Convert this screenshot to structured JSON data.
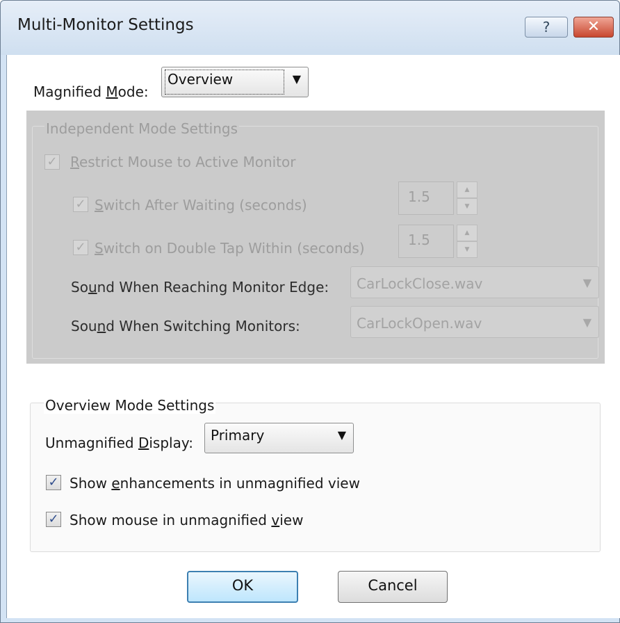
{
  "window": {
    "title": "Multi-Monitor Settings",
    "help_glyph": "?",
    "close_glyph": "✕"
  },
  "magnified_mode": {
    "label_pre": "Magnified ",
    "label_key": "M",
    "label_post": "ode:",
    "value": "Overview"
  },
  "independent": {
    "group_title": "Independent Mode Settings",
    "restrict_mouse": {
      "key": "R",
      "rest": "estrict Mouse to Active Monitor",
      "checked": true
    },
    "switch_after_waiting": {
      "key": "S",
      "rest": "witch After Waiting (seconds)",
      "value": "1.5",
      "checked": true
    },
    "switch_double_tap": {
      "key": "S",
      "rest": "witch on Double Tap Within (seconds)",
      "value": "1.5",
      "checked": true
    },
    "sound_edge": {
      "pre": "So",
      "key": "u",
      "post": "nd When Reaching Monitor Edge:",
      "value": "CarLockClose.wav"
    },
    "sound_switch": {
      "pre": "Sou",
      "key": "n",
      "post": "d When Switching Monitors:",
      "value": "CarLockOpen.wav"
    }
  },
  "overview": {
    "group_title": "Overview Mode Settings",
    "unmagnified_display": {
      "pre": "Unmagnified ",
      "key": "D",
      "post": "isplay:",
      "value": "Primary"
    },
    "show_enhancements": {
      "pre": "Show ",
      "key": "e",
      "post": "nhancements in unmagnified view",
      "checked": true
    },
    "show_mouse": {
      "pre": "Show mouse in unmagnified ",
      "key": "v",
      "post": "iew",
      "checked": true
    }
  },
  "buttons": {
    "ok": "OK",
    "cancel": "Cancel"
  },
  "icons": {
    "check": "✓",
    "dropdown": "▼",
    "spin_up": "▲",
    "spin_down": "▼"
  },
  "colors": {
    "title_bar": "#d3e3f4",
    "disabled_panel": "#cbcbcb",
    "close_button": "#c8472f",
    "default_button_border": "#3c7fb1"
  }
}
